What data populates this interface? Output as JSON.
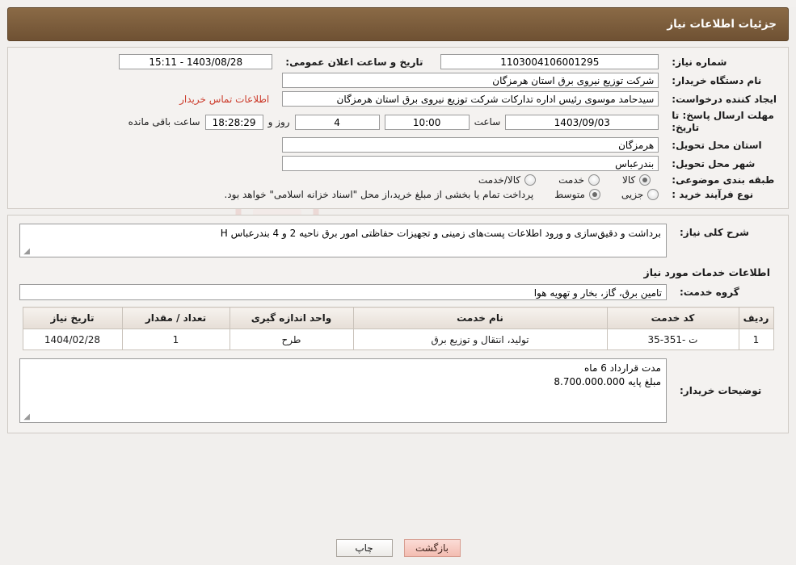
{
  "header": {
    "title": "جزئیات اطلاعات نیاز"
  },
  "form": {
    "need_number_label": "شماره نیاز:",
    "need_number_value": "1103004106001295",
    "announce_datetime_label": "تاریخ و ساعت اعلان عمومی:",
    "announce_datetime_value": "1403/08/28 - 15:11",
    "buyer_org_label": "نام دستگاه خریدار:",
    "buyer_org_value": "شرکت توزیع نیروی برق استان هرمزگان",
    "requester_label": "ایجاد کننده درخواست:",
    "requester_value": "سیدحامد موسوی رئیس اداره تدارکات شرکت توزیع نیروی برق استان هرمزگان",
    "buyer_contact_link": "اطلاعات تماس خریدار",
    "deadline_label": "مهلت ارسال پاسخ: تا تاریخ:",
    "deadline_date": "1403/09/03",
    "hour_label": "ساعت",
    "deadline_time": "10:00",
    "days_value": "4",
    "days_label": "روز و",
    "countdown_value": "18:28:29",
    "remaining_label": "ساعت باقی مانده",
    "province_label": "استان محل تحویل:",
    "province_value": "هرمزگان",
    "city_label": "شهر محل تحویل:",
    "city_value": "بندرعباس",
    "category_label": "طبقه بندی موضوعی:",
    "category_options": [
      {
        "label": "کالا",
        "checked": true
      },
      {
        "label": "خدمت",
        "checked": false
      },
      {
        "label": "کالا/خدمت",
        "checked": false
      }
    ],
    "process_label": "نوع فرآیند خرید :",
    "process_options": [
      {
        "label": "جزیی",
        "checked": false
      },
      {
        "label": "متوسط",
        "checked": true
      }
    ],
    "process_note": "پرداخت تمام یا بخشی از مبلغ خرید،از محل \"اسناد خزانه اسلامی\" خواهد بود."
  },
  "description": {
    "label": "شرح کلی نیاز:",
    "value": "برداشت و دقیق‌سازی و ورود اطلاعات پست‌های زمینی و تجهیزات حفاظتی امور برق ناحیه 2 و 4 بندرعباس H"
  },
  "services": {
    "section_title": "اطلاعات خدمات مورد نیاز",
    "group_label": "گروه خدمت:",
    "group_value": "تامین برق، گاز، بخار و تهویه هوا",
    "columns": [
      "ردیف",
      "کد خدمت",
      "نام خدمت",
      "واحد اندازه گیری",
      "تعداد / مقدار",
      "تاریخ نیاز"
    ],
    "rows": [
      {
        "index": "1",
        "code": "ت -351-35",
        "name": "تولید، انتقال و توزیع برق",
        "unit": "طرح",
        "quantity": "1",
        "date": "1404/02/28"
      }
    ]
  },
  "buyer_notes": {
    "label": "توضیحات خریدار:",
    "line1": "مدت قرارداد 6 ماه",
    "line2": "مبلغ پایه 8.700.000.000"
  },
  "footer": {
    "print_label": "چاپ",
    "back_label": "بازگشت"
  },
  "watermark": {
    "text": "AriaTender.com"
  }
}
